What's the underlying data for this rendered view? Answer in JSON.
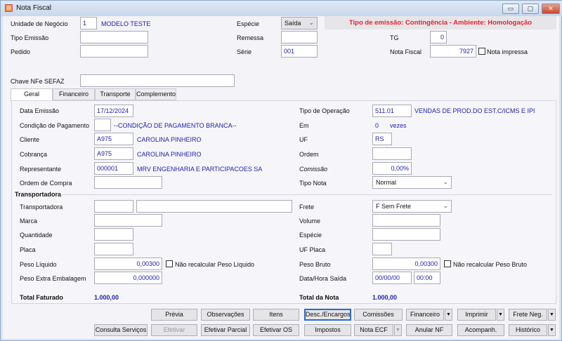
{
  "window": {
    "title": "Nota Fiscal",
    "minimize": "▭",
    "maximize": "▢",
    "close": "✕"
  },
  "header": {
    "unidade_label": "Unidade de Negócio",
    "unidade_code": "1",
    "unidade_name": "MODELO TESTE",
    "especie_label": "Espécie",
    "especie_value": "Saída",
    "emissao_banner": "Tipo de emissão: Contingência - Ambiente: Homologação",
    "tipo_emissao_label": "Tipo Emissão",
    "tipo_emissao_value": "",
    "remessa_label": "Remessa",
    "remessa_value": "",
    "tg_label": "TG",
    "tg_value": "0",
    "pedido_label": "Pedido",
    "pedido_value": "",
    "serie_label": "Série",
    "serie_value": "001",
    "nota_fiscal_label": "Nota Fiscal",
    "nota_fiscal_value": "7927",
    "nota_impressa_label": "Nota impressa",
    "nota_impressa_checked": false,
    "chave_label": "Chave NFe SEFAZ",
    "chave_value": ""
  },
  "tabs": [
    {
      "label": "Geral",
      "active": true
    },
    {
      "label": "Financeiro"
    },
    {
      "label": "Transporte"
    },
    {
      "label": "Complemento"
    }
  ],
  "geral": {
    "data_emissao_label": "Data Emissão",
    "data_emissao": "17/12/2024",
    "condicao_label": "Condição de Pagamento",
    "condicao_code": "",
    "condicao_desc": "--CONDIÇÃO DE PAGAMENTO BRANCA--",
    "cliente_label": "Cliente",
    "cliente_code": "A975",
    "cliente_name": "CAROLINA PINHEIRO",
    "cobranca_label": "Cobrança",
    "cobranca_code": "A975",
    "cobranca_name": "CAROLINA PINHEIRO",
    "representante_label": "Representante",
    "representante_code": "000001",
    "representante_name": "MRV ENGENHARIA E PARTICIPACOES SA",
    "ordem_compra_label": "Ordem de Compra",
    "ordem_compra": "",
    "tipo_operacao_label": "Tipo de Operação",
    "tipo_operacao_code": "511.01",
    "tipo_operacao_desc": "VENDAS DE PROD.DO EST.C/ICMS E IPI",
    "em_label": "Em",
    "em_value": "0",
    "vezes_label": "vezes",
    "uf_label": "UF",
    "uf_value": "RS",
    "ordem_label": "Ordem",
    "ordem_value": "",
    "comissao_label": "Comissão",
    "comissao_value": "0,00%",
    "tipo_nota_label": "Tipo Nota",
    "tipo_nota_value": "Normal"
  },
  "transportadora": {
    "section_label": "Transportadora",
    "transportadora_label": "Transportadora",
    "transportadora_code": "",
    "transportadora_name": "",
    "marca_label": "Marca",
    "marca": "",
    "quantidade_label": "Quantidade",
    "quantidade": "",
    "placa_label": "Placa",
    "placa": "",
    "peso_liquido_label": "Peso Líquido",
    "peso_liquido": "0,00300",
    "nao_recalc_liq_label": "Não recalcular Peso Líquido",
    "peso_extra_label": "Peso Extra Embalagem",
    "peso_extra": "0,000000",
    "frete_label": "Frete",
    "frete_value": "F Sem Frete",
    "volume_label": "Volume",
    "volume": "",
    "especie_label": "Espécie",
    "especie": "",
    "uf_placa_label": "UF Placa",
    "uf_placa": "",
    "peso_bruto_label": "Peso Bruto",
    "peso_bruto": "0,00300",
    "nao_recalc_bruto_label": "Não recalcular Peso Bruto",
    "data_hora_saida_label": "Data/Hora Saída",
    "data_saida": "00/00/00",
    "hora_saida": "00:00"
  },
  "totals": {
    "faturado_label": "Total Faturado",
    "faturado": "1.000,00",
    "nota_label": "Total da Nota",
    "nota": "1.000,00"
  },
  "buttons": {
    "previa": "Prévia",
    "observacoes": "Observações",
    "itens": "Itens",
    "desc_encargos": "Desc./Encargos",
    "comissoes": "Comissões",
    "financeiro": "Financeiro",
    "imprimir": "Imprimir",
    "frete_neg": "Frete Neg.",
    "consulta_servicos": "Consulta Serviços",
    "efetivar": "Efetivar",
    "efetivar_parcial": "Efetivar Parcial",
    "efetivar_os": "Efetivar OS",
    "impostos": "Impostos",
    "nota_ecf": "Nota ECF",
    "anular_nf": "Anular NF",
    "acompanh": "Acompanh.",
    "historico": "Histórico"
  },
  "colors": {
    "accent_text": "#2020b0",
    "banner_text": "#e8202a"
  }
}
